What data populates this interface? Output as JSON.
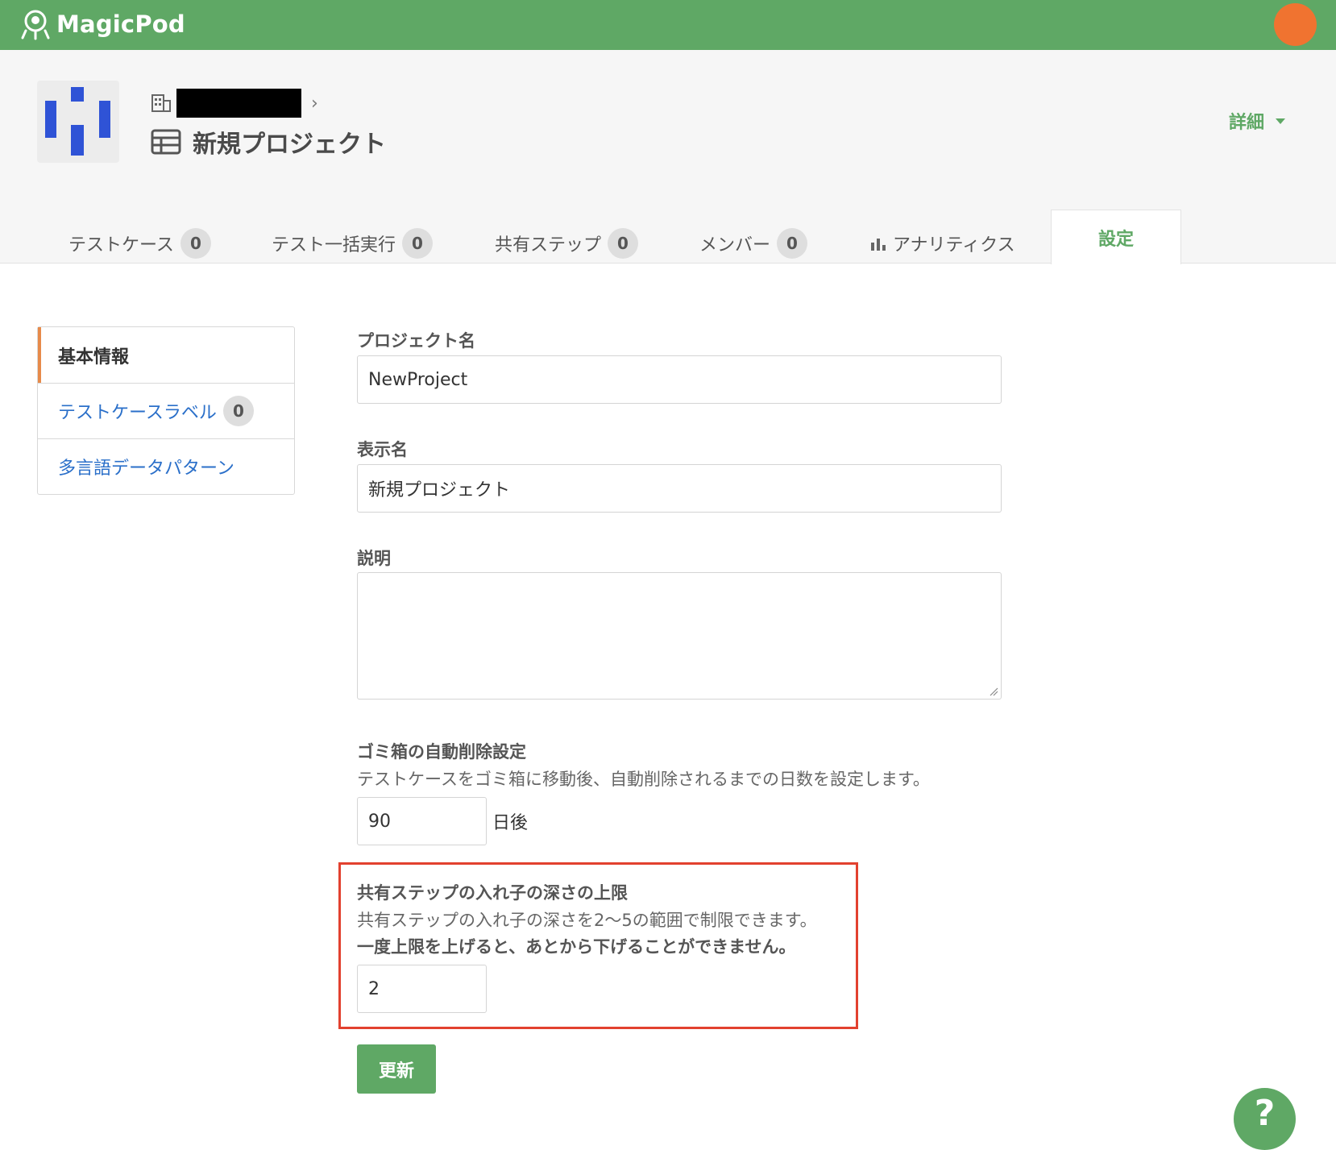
{
  "app": {
    "name": "MagicPod"
  },
  "header": {
    "project_title": "新規プロジェクト",
    "details_label": "詳細"
  },
  "tabs": [
    {
      "label": "テストケース",
      "count": "0"
    },
    {
      "label": "テスト一括実行",
      "count": "0"
    },
    {
      "label": "共有ステップ",
      "count": "0"
    },
    {
      "label": "メンバー",
      "count": "0"
    },
    {
      "label": "アナリティクス"
    },
    {
      "label": "設定",
      "active": true
    }
  ],
  "sidebar": {
    "items": [
      {
        "label": "基本情報",
        "active": true
      },
      {
        "label": "テストケースラベル",
        "count": "0"
      },
      {
        "label": "多言語データパターン"
      }
    ]
  },
  "form": {
    "project_name_label": "プロジェクト名",
    "project_name_value": "NewProject",
    "display_name_label": "表示名",
    "display_name_value": "新規プロジェクト",
    "description_label": "説明",
    "trash_label": "ゴミ箱の自動削除設定",
    "trash_help": "テストケースをゴミ箱に移動後、自動削除されるまでの日数を設定します。",
    "trash_days_value": "90",
    "trash_days_unit": "日後",
    "nest_label": "共有ステップの入れ子の深さの上限",
    "nest_help": "共有ステップの入れ子の深さを2〜5の範囲で制限できます。",
    "nest_warning": "一度上限を上げると、あとから下げることができません。",
    "nest_value": "2",
    "submit_label": "更新"
  },
  "help_button": {
    "label": "?"
  },
  "colors": {
    "brand_green": "#5fa865",
    "avatar": "#f07330",
    "highlight": "#e2412f",
    "link": "#2a6fc9"
  }
}
